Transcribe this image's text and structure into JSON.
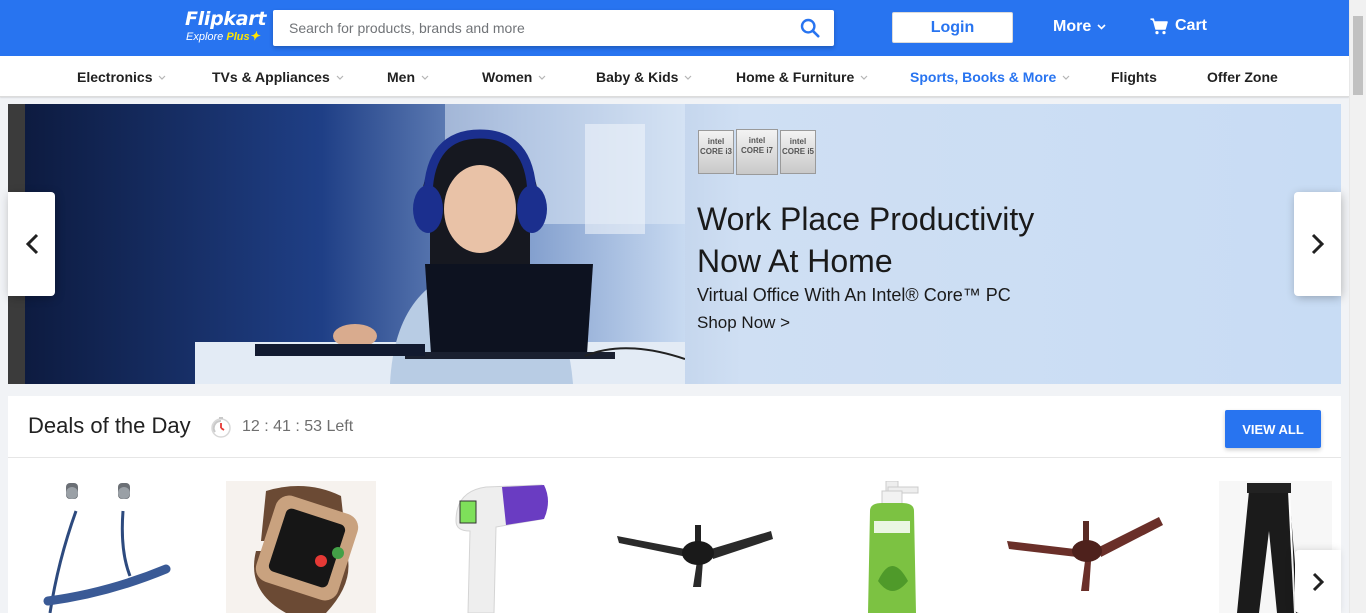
{
  "header": {
    "logo_text": "Flipkart",
    "logo_tagline": "Explore",
    "logo_plus": "Plus",
    "search_placeholder": "Search for products, brands and more",
    "login_label": "Login",
    "more_label": "More",
    "cart_label": "Cart",
    "brand_color": "#2874f0",
    "accent_color": "#ffe500"
  },
  "categories": [
    {
      "label": "Electronics",
      "has_dropdown": true
    },
    {
      "label": "TVs & Appliances",
      "has_dropdown": true
    },
    {
      "label": "Men",
      "has_dropdown": true
    },
    {
      "label": "Women",
      "has_dropdown": true
    },
    {
      "label": "Baby & Kids",
      "has_dropdown": true
    },
    {
      "label": "Home & Furniture",
      "has_dropdown": true
    },
    {
      "label": "Sports, Books & More",
      "has_dropdown": true,
      "active": true
    },
    {
      "label": "Flights",
      "has_dropdown": false
    },
    {
      "label": "Offer Zone",
      "has_dropdown": false
    }
  ],
  "banner": {
    "title_line1": "Work Place Productivity",
    "title_line2": "Now At Home",
    "subtitle": "Virtual Office With An Intel® Core™ PC",
    "cta": "Shop Now >",
    "chips": [
      "CORE i3",
      "CORE i7",
      "CORE i5"
    ],
    "chip_brand": "intel"
  },
  "deals": {
    "title": "Deals of the Day",
    "timer": "12 : 41 : 53 Left",
    "view_all_label": "VIEW ALL",
    "products": [
      {
        "icon": "neckband-earphones-icon"
      },
      {
        "icon": "smartwatch-icon"
      },
      {
        "icon": "infrared-thermometer-icon"
      },
      {
        "icon": "black-ceiling-fan-icon"
      },
      {
        "icon": "face-wash-bottle-icon"
      },
      {
        "icon": "brown-ceiling-fan-icon"
      },
      {
        "icon": "track-pants-icon"
      }
    ]
  }
}
